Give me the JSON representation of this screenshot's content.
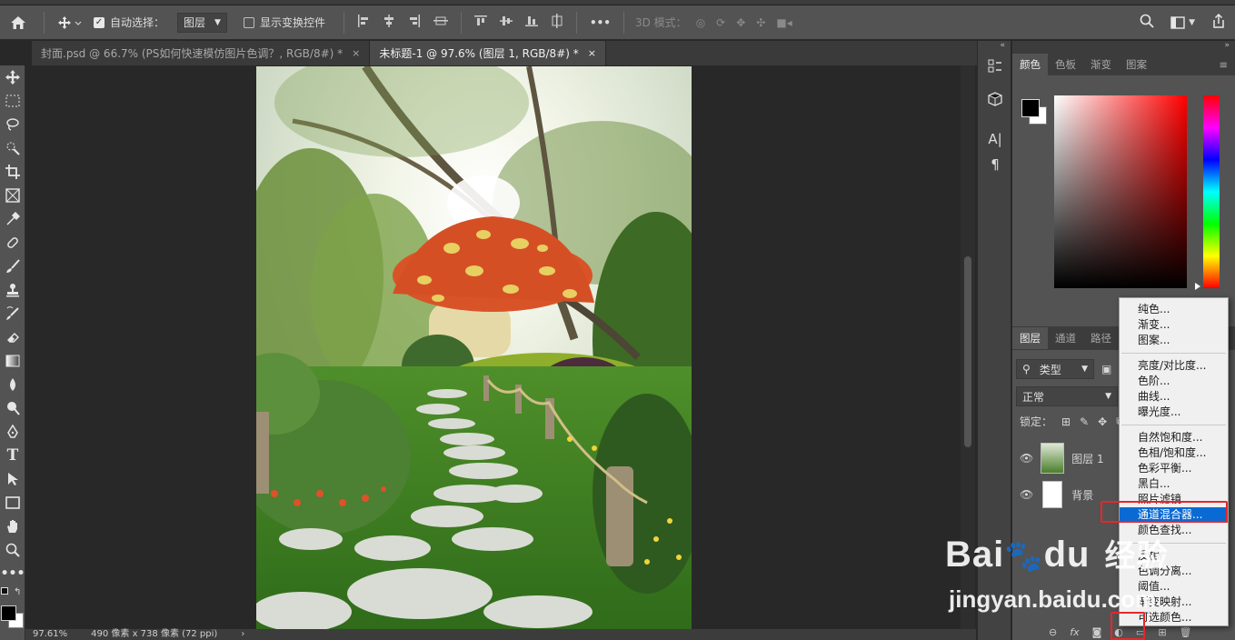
{
  "options_bar": {
    "auto_select_label": "自动选择：",
    "auto_select_value": "图层",
    "show_transform_label": "显示变换控件",
    "mode_3d_label": "3D 模式：",
    "more_label": "•••"
  },
  "tabs": [
    {
      "label": "封面.psd @ 66.7% (PS如何快速模仿图片色调？, RGB/8#) *",
      "close": "×"
    },
    {
      "label": "未标题-1 @ 97.6% (图层 1, RGB/8#) *",
      "close": "×"
    }
  ],
  "status": {
    "zoom": "97.61%",
    "doc_info": "490 像素 x 738 像素 (72 ppi)",
    "arrow": "›"
  },
  "color_panel": {
    "tabs": [
      "颜色",
      "色板",
      "渐变",
      "图案"
    ]
  },
  "layers_panel": {
    "tabs": [
      "图层",
      "通道",
      "路径"
    ],
    "filter_kind": "类型",
    "blend_mode": "正常",
    "lock_label": "锁定：",
    "layers": [
      {
        "name": "图层 1"
      },
      {
        "name": "背景"
      }
    ]
  },
  "adjust_menu": {
    "groups": [
      [
        "纯色...",
        "渐变...",
        "图案..."
      ],
      [
        "亮度/对比度...",
        "色阶...",
        "曲线...",
        "曝光度..."
      ],
      [
        "自然饱和度...",
        "色相/饱和度...",
        "色彩平衡...",
        "黑白...",
        "照片滤镜...",
        "通道混合器...",
        "颜色查找..."
      ],
      [
        "反相",
        "色调分离...",
        "阈值...",
        "渐变映射...",
        "可选颜色..."
      ]
    ],
    "highlighted": "通道混合器..."
  },
  "watermark": {
    "brand": "Bai",
    "brand2": "du",
    "cn": "经验",
    "url": "jingyan.baidu.com"
  },
  "colors": {
    "accent": "#0a6ad3",
    "highlight_box": "#e8262a",
    "panel_bg": "#535353"
  }
}
